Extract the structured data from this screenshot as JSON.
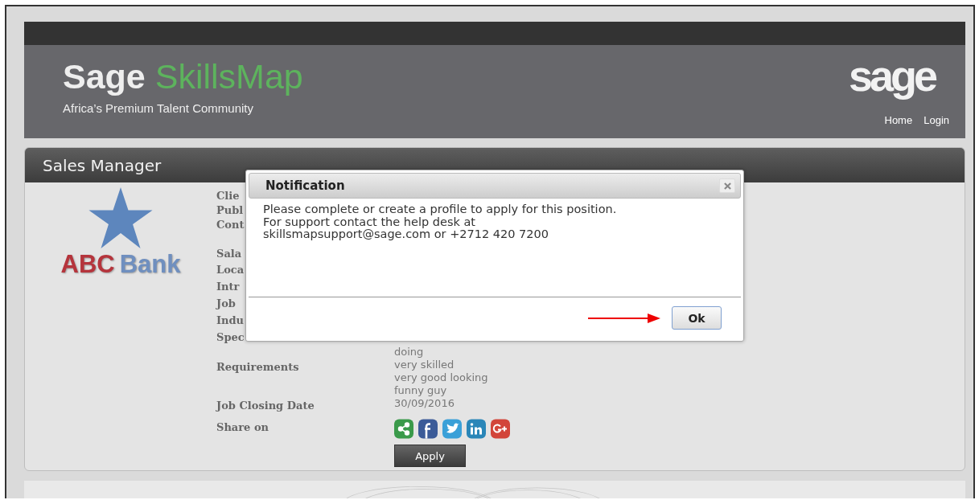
{
  "header": {
    "brand_first": "Sage",
    "brand_second": "SkillsMap",
    "tagline": "Africa’s Premium Talent Community",
    "logo_text": "sage",
    "nav": [
      "Home",
      "Login"
    ]
  },
  "job": {
    "title": "Sales Manager",
    "company_logo": {
      "first": "ABC",
      "second": "Bank"
    },
    "details": [
      {
        "label": "Clie"
      },
      {
        "label": "Publ"
      },
      {
        "label": "Cont"
      },
      {
        "label": "Sala"
      },
      {
        "label": "Loca"
      },
      {
        "label": "Intr"
      },
      {
        "label": "Job"
      },
      {
        "label": "Indu"
      },
      {
        "label": "Spec"
      },
      {
        "values": [
          "doing"
        ]
      },
      {
        "label": "Requirements",
        "values": [
          "very skilled",
          "very good looking",
          "funny guy"
        ]
      },
      {
        "label": "Job Closing Date",
        "values": [
          "30/09/2016"
        ]
      }
    ],
    "share_label": "Share on",
    "share_icons": [
      {
        "kind": "share"
      },
      {
        "kind": "facebook"
      },
      {
        "kind": "twitter"
      },
      {
        "kind": "linkedin"
      },
      {
        "kind": "googleplus"
      }
    ],
    "apply_button": "Apply"
  },
  "dialog": {
    "title": "Notification",
    "lines": [
      "Please complete or create a profile to apply for this position.",
      "For support contact the help desk at",
      "skillsmapsupport@sage.com or +2712 420 7200"
    ],
    "ok_button": "Ok"
  }
}
